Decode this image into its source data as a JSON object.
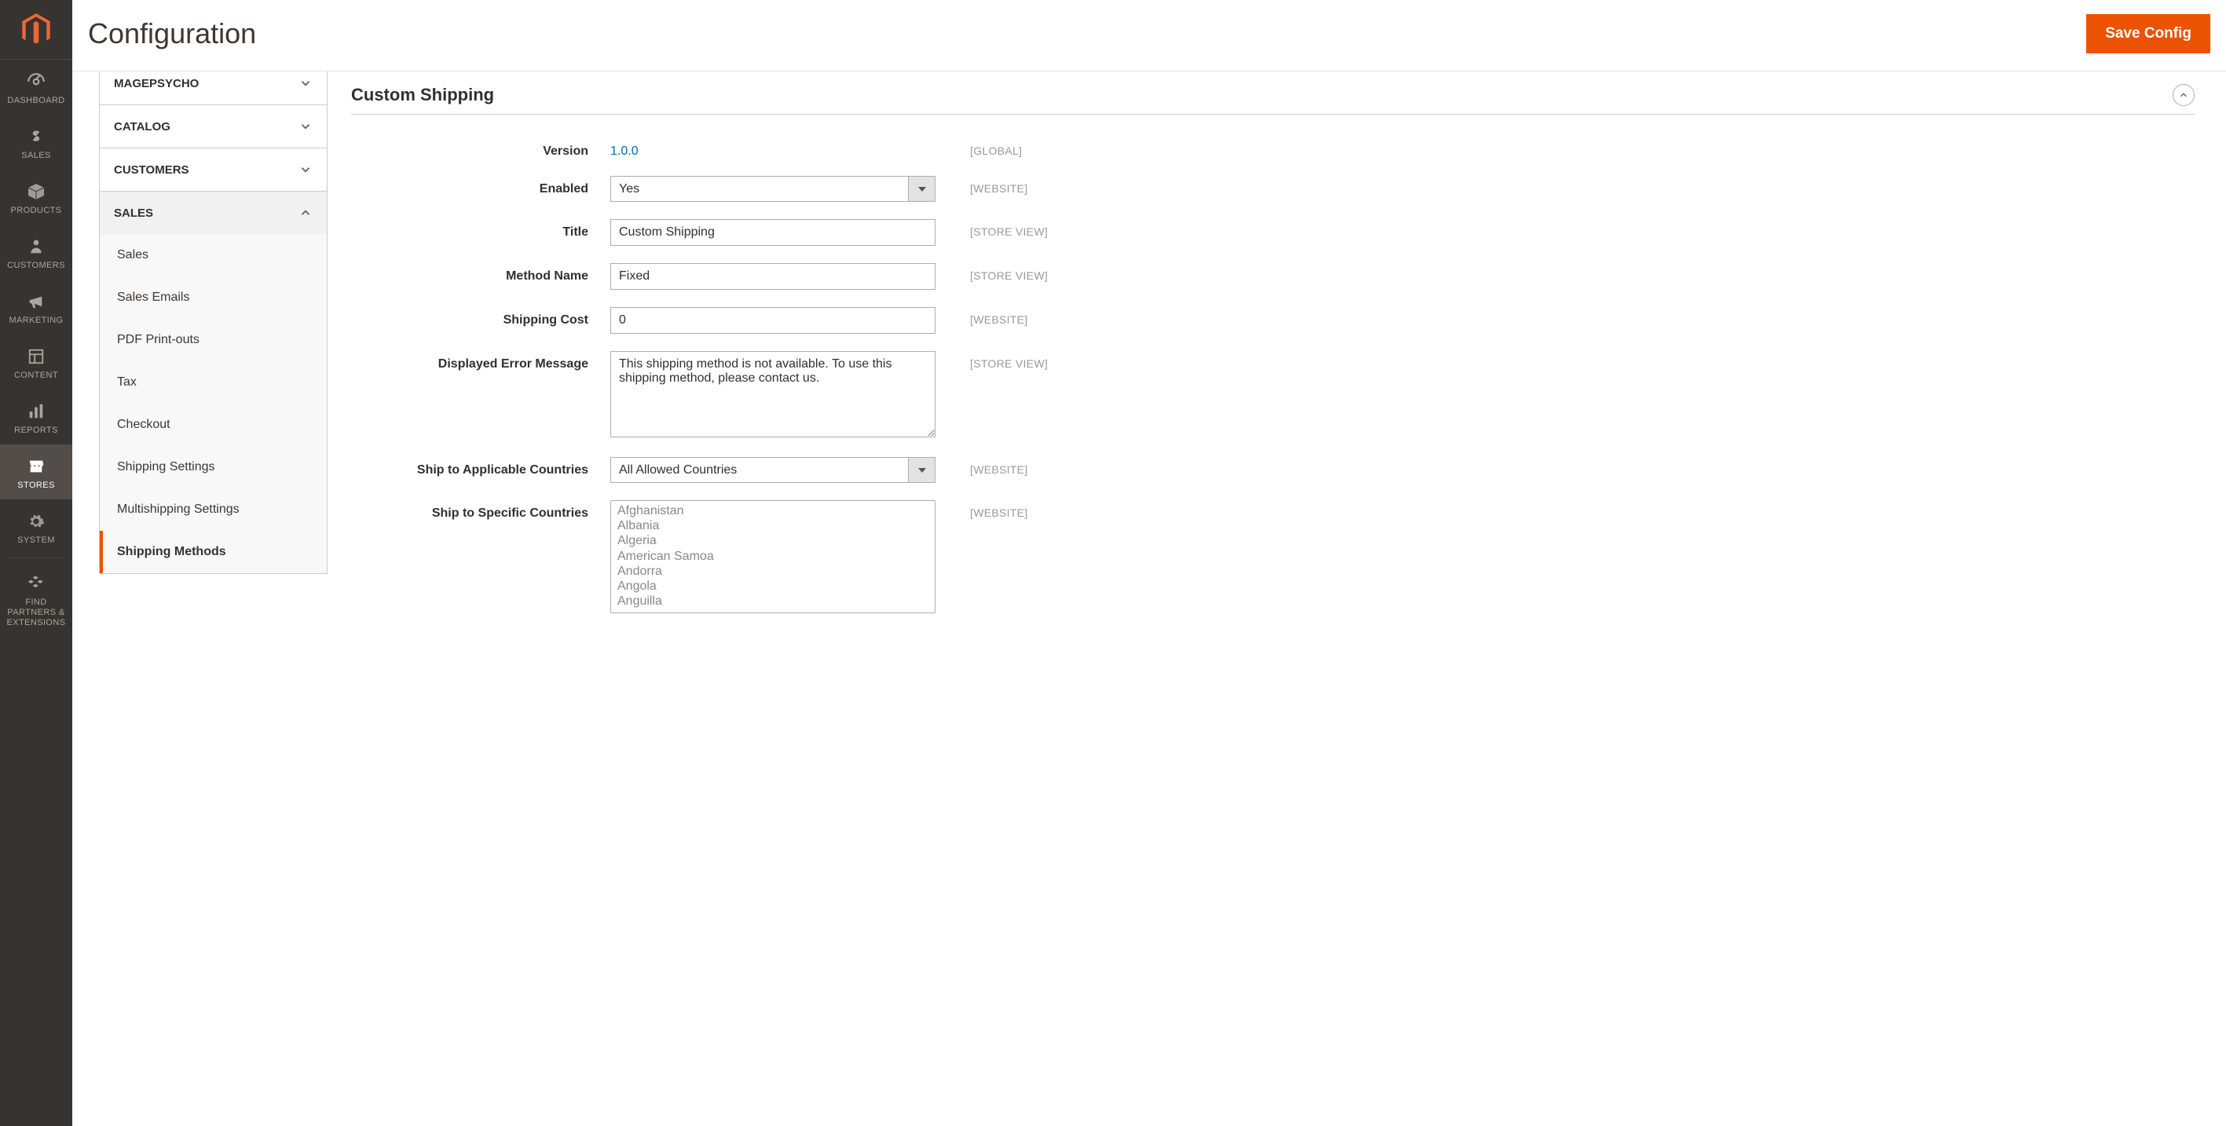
{
  "nav": {
    "items": [
      {
        "label": "DASHBOARD",
        "icon": "gauge"
      },
      {
        "label": "SALES",
        "icon": "dollar"
      },
      {
        "label": "PRODUCTS",
        "icon": "box"
      },
      {
        "label": "CUSTOMERS",
        "icon": "person"
      },
      {
        "label": "MARKETING",
        "icon": "megaphone"
      },
      {
        "label": "CONTENT",
        "icon": "layout"
      },
      {
        "label": "REPORTS",
        "icon": "bars"
      },
      {
        "label": "STORES",
        "icon": "storefront"
      },
      {
        "label": "SYSTEM",
        "icon": "gear"
      },
      {
        "label": "FIND PARTNERS & EXTENSIONS",
        "icon": "blocks"
      }
    ],
    "active_index": 7
  },
  "page_title": "Configuration",
  "save_label": "Save Config",
  "tabs": {
    "categories": [
      {
        "label": "MAGEPSYCHO",
        "expanded": false
      },
      {
        "label": "CATALOG",
        "expanded": false
      },
      {
        "label": "CUSTOMERS",
        "expanded": false
      },
      {
        "label": "SALES",
        "expanded": true,
        "items": [
          {
            "label": "Sales"
          },
          {
            "label": "Sales Emails"
          },
          {
            "label": "PDF Print-outs"
          },
          {
            "label": "Tax"
          },
          {
            "label": "Checkout"
          },
          {
            "label": "Shipping Settings"
          },
          {
            "label": "Multishipping Settings"
          },
          {
            "label": "Shipping Methods",
            "active": true
          }
        ]
      }
    ]
  },
  "section": {
    "title": "Custom Shipping",
    "fields": {
      "version": {
        "label": "Version",
        "value": "1.0.0",
        "scope": "[GLOBAL]",
        "type": "static"
      },
      "enabled": {
        "label": "Enabled",
        "value": "Yes",
        "scope": "[WEBSITE]",
        "type": "select"
      },
      "title": {
        "label": "Title",
        "value": "Custom Shipping",
        "scope": "[STORE VIEW]",
        "type": "text"
      },
      "method_name": {
        "label": "Method Name",
        "value": "Fixed",
        "scope": "[STORE VIEW]",
        "type": "text"
      },
      "shipping_cost": {
        "label": "Shipping Cost",
        "value": "0",
        "scope": "[WEBSITE]",
        "type": "text"
      },
      "error_message": {
        "label": "Displayed Error Message",
        "value": "This shipping method is not available. To use this shipping method, please contact us.",
        "scope": "[STORE VIEW]",
        "type": "textarea"
      },
      "ship_applicable": {
        "label": "Ship to Applicable Countries",
        "value": "All Allowed Countries",
        "scope": "[WEBSITE]",
        "type": "select"
      },
      "ship_specific": {
        "label": "Ship to Specific Countries",
        "scope": "[WEBSITE]",
        "type": "multiselect",
        "options": [
          "Afghanistan",
          "Albania",
          "Algeria",
          "American Samoa",
          "Andorra",
          "Angola",
          "Anguilla"
        ]
      }
    }
  }
}
